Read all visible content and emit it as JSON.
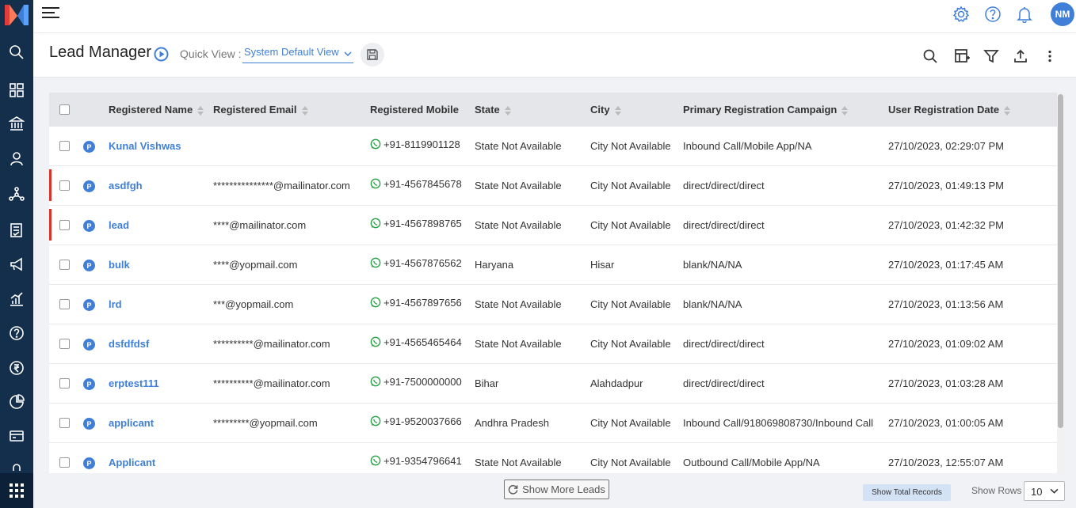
{
  "topbar": {
    "avatar_initials": "NM"
  },
  "header": {
    "title": "Lead Manager",
    "quick_view_label": "Quick View :",
    "quick_view_value": "System Default View"
  },
  "table": {
    "columns": [
      "Registered Name",
      "Registered Email",
      "Registered Mobile",
      "State",
      "City",
      "Primary Registration Campaign",
      "User Registration Date"
    ],
    "rows": [
      {
        "badge": "P",
        "name": "Kunal Vishwas",
        "email": "",
        "mobile": "+91-8119901128",
        "state": "State Not Available",
        "city": "City Not Available",
        "campaign": "Inbound Call/Mobile App/NA",
        "date": "27/10/2023, 02:29:07 PM",
        "flag": false
      },
      {
        "badge": "P",
        "name": "asdfgh",
        "email": "***************@mailinator.com",
        "mobile": "+91-4567845678",
        "state": "State Not Available",
        "city": "City Not Available",
        "campaign": "direct/direct/direct",
        "date": "27/10/2023, 01:49:13 PM",
        "flag": true
      },
      {
        "badge": "P",
        "name": "lead",
        "email": "****@mailinator.com",
        "mobile": "+91-4567898765",
        "state": "State Not Available",
        "city": "City Not Available",
        "campaign": "direct/direct/direct",
        "date": "27/10/2023, 01:42:32 PM",
        "flag": true
      },
      {
        "badge": "P",
        "name": "bulk",
        "email": "****@yopmail.com",
        "mobile": "+91-4567876562",
        "state": "Haryana",
        "city": "Hisar",
        "campaign": "blank/NA/NA",
        "date": "27/10/2023, 01:17:45 AM",
        "flag": false
      },
      {
        "badge": "P",
        "name": "lrd",
        "email": "***@yopmail.com",
        "mobile": "+91-4567897656",
        "state": "State Not Available",
        "city": "City Not Available",
        "campaign": "blank/NA/NA",
        "date": "27/10/2023, 01:13:56 AM",
        "flag": false
      },
      {
        "badge": "P",
        "name": "dsfdfdsf",
        "email": "**********@mailinator.com",
        "mobile": "+91-4565465464",
        "state": "State Not Available",
        "city": "City Not Available",
        "campaign": "direct/direct/direct",
        "date": "27/10/2023, 01:09:02 AM",
        "flag": false
      },
      {
        "badge": "P",
        "name": "erptest111",
        "email": "**********@mailinator.com",
        "mobile": "+91-7500000000",
        "state": "Bihar",
        "city": "Alahdadpur",
        "campaign": "direct/direct/direct",
        "date": "27/10/2023, 01:03:28 AM",
        "flag": false
      },
      {
        "badge": "P",
        "name": "applicant",
        "email": "*********@yopmail.com",
        "mobile": "+91-9520037666",
        "state": "Andhra Pradesh",
        "city": "City Not Available",
        "campaign": "Inbound Call/918069808730/Inbound Call",
        "date": "27/10/2023, 01:00:05 AM",
        "flag": false
      },
      {
        "badge": "P",
        "name": "Applicant",
        "email": "",
        "mobile": "+91-9354796641",
        "state": "State Not Available",
        "city": "City Not Available",
        "campaign": "Outbound Call/Mobile App/NA",
        "date": "27/10/2023, 12:55:07 AM",
        "flag": false
      }
    ]
  },
  "footer": {
    "show_more": "Show More Leads",
    "show_total": "Show Total Records",
    "show_rows_label": "Show Rows",
    "show_rows_value": "10"
  },
  "colors": {
    "accent": "#3f7fd8",
    "sidebar": "#132f4c",
    "flag": "#d9342b",
    "whatsapp": "#25a244"
  },
  "icons": {
    "sidebar": [
      "search-icon",
      "dashboard-icon",
      "institution-icon",
      "user-icon",
      "network-icon",
      "checklist-icon",
      "megaphone-icon",
      "chart-icon",
      "help-icon",
      "rupee-icon",
      "pie-chart-icon",
      "card-icon",
      "lock-icon"
    ],
    "topbar": [
      "gear-icon",
      "help-icon",
      "bell-icon"
    ],
    "toolbar": [
      "search-icon",
      "add-column-icon",
      "filter-icon",
      "upload-icon",
      "more-vertical-icon"
    ]
  }
}
